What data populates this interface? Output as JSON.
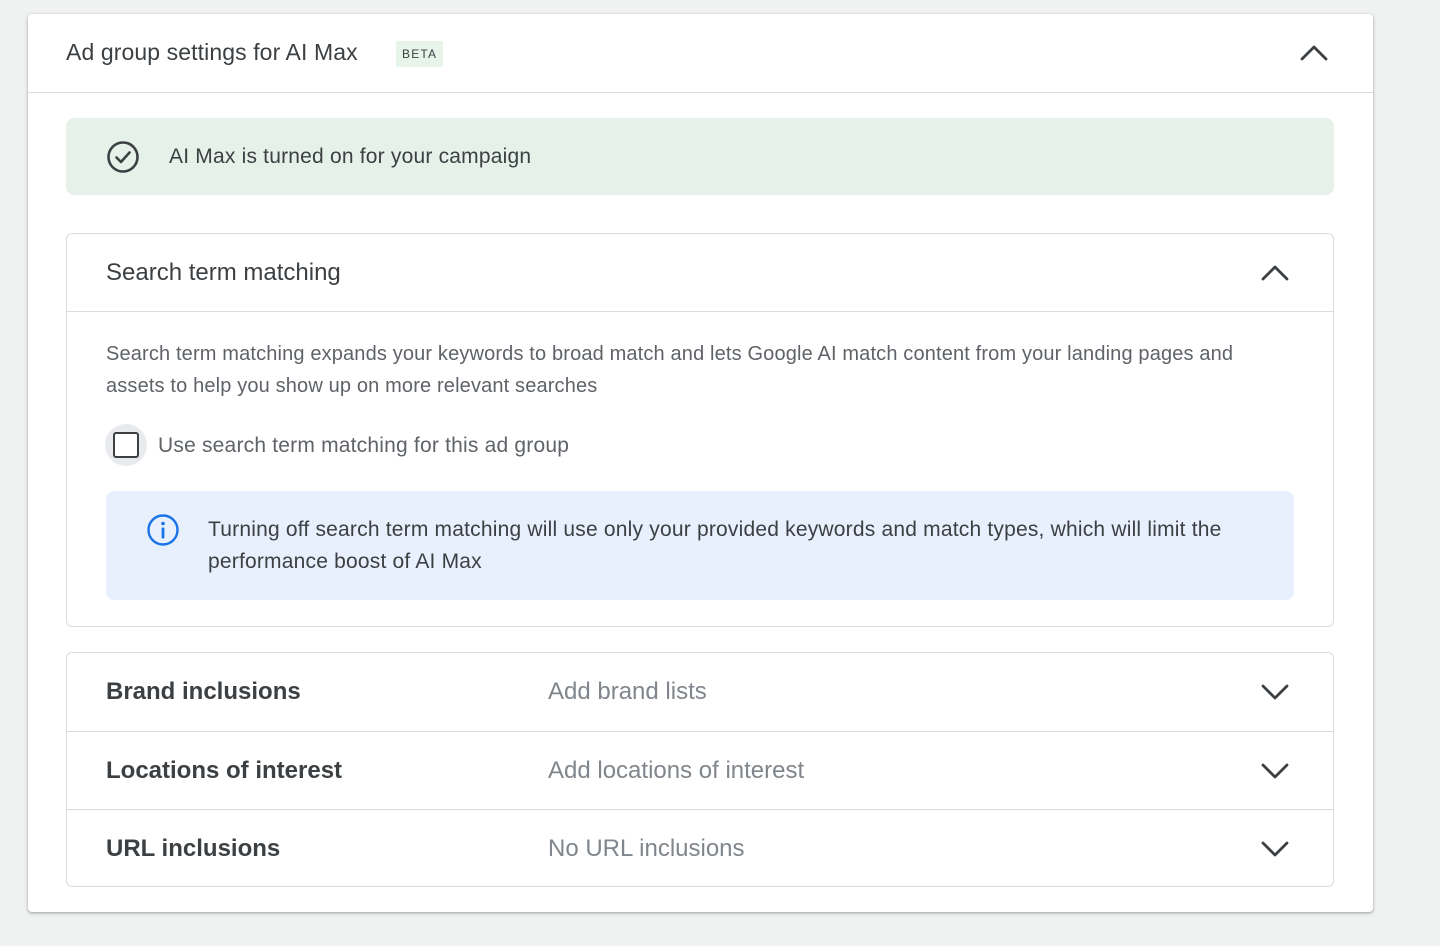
{
  "card": {
    "title": "Ad group settings for AI Max",
    "badge": "BETA",
    "collapse_icon": "chevron-up-icon"
  },
  "status_banner": {
    "icon": "check-circle-icon",
    "text": "AI Max is turned on for your campaign"
  },
  "search_term_matching": {
    "title": "Search term matching",
    "collapse_icon": "chevron-up-icon",
    "description": "Search term matching expands your keywords to broad match and lets Google AI match content from your landing pages and assets to help you show up on more relevant searches",
    "checkbox": {
      "label": "Use search term matching for this ad group",
      "checked": false
    },
    "info": {
      "icon": "info-icon",
      "text": "Turning off search term matching will use only your provided keywords and match types, which will limit the performance boost of AI Max"
    }
  },
  "settings": [
    {
      "label": "Brand inclusions",
      "value": "Add brand lists",
      "icon": "chevron-down-icon"
    },
    {
      "label": "Locations of interest",
      "value": "Add locations of interest",
      "icon": "chevron-down-icon"
    },
    {
      "label": "URL inclusions",
      "value": "No URL inclusions",
      "icon": "chevron-down-icon"
    }
  ],
  "colors": {
    "success_bg": "#e6f1ea",
    "info_bg": "#e8f0fe",
    "info_accent": "#1a73e8",
    "text_primary": "#3c4043",
    "text_secondary": "#80868b"
  }
}
